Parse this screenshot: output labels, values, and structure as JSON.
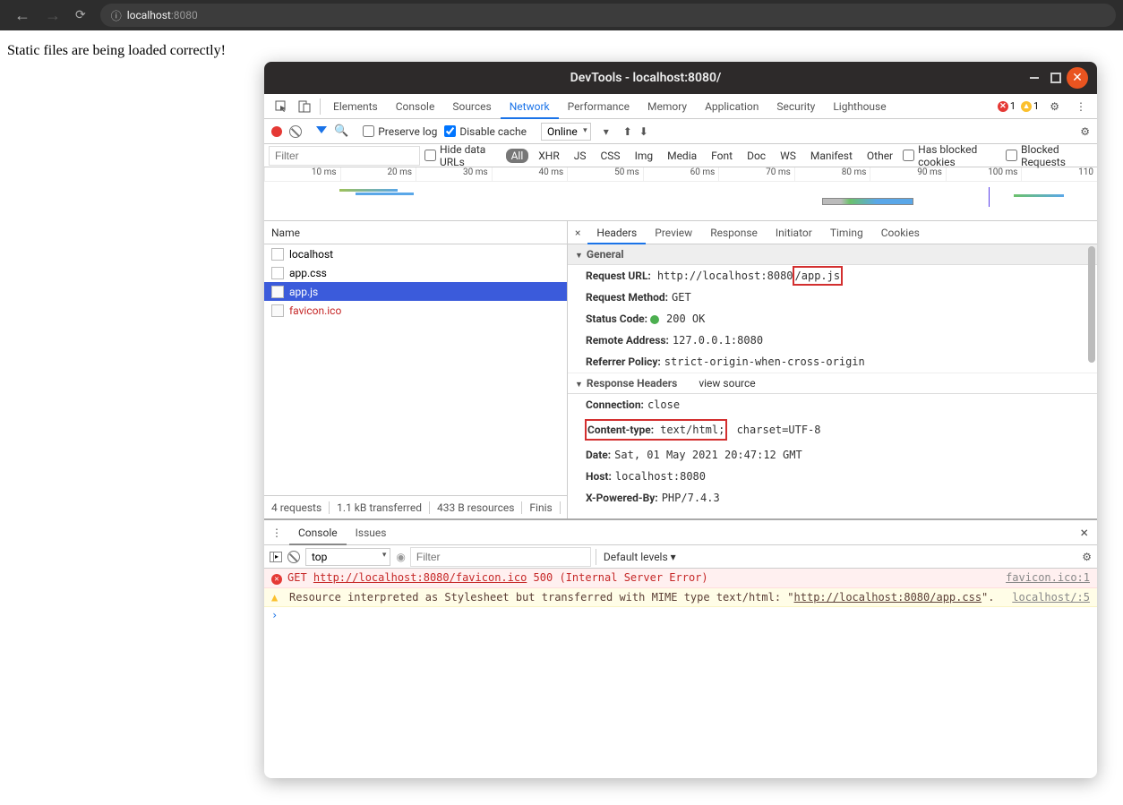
{
  "browser": {
    "url_host": "localhost",
    "url_port": ":8080",
    "info_icon": "ⓘ"
  },
  "page": {
    "body_text": "Static files are being loaded correctly!"
  },
  "devtools": {
    "title": "DevTools - localhost:8080/",
    "tabs": [
      "Elements",
      "Console",
      "Sources",
      "Network",
      "Performance",
      "Memory",
      "Application",
      "Security",
      "Lighthouse"
    ],
    "active_tab": "Network",
    "error_count": "1",
    "warn_count": "1"
  },
  "net_toolbar": {
    "preserve_log": "Preserve log",
    "disable_cache": "Disable cache",
    "throttle": "Online"
  },
  "net_filter": {
    "placeholder": "Filter",
    "hide_data": "Hide data URLs",
    "types": [
      "All",
      "XHR",
      "JS",
      "CSS",
      "Img",
      "Media",
      "Font",
      "Doc",
      "WS",
      "Manifest",
      "Other"
    ],
    "blocked_cookies": "Has blocked cookies",
    "blocked_req": "Blocked Requests"
  },
  "waterfall_labels": [
    "10 ms",
    "20 ms",
    "30 ms",
    "40 ms",
    "50 ms",
    "60 ms",
    "70 ms",
    "80 ms",
    "90 ms",
    "100 ms",
    "110"
  ],
  "requests": {
    "header": "Name",
    "rows": [
      {
        "name": "localhost",
        "cls": "doc"
      },
      {
        "name": "app.css",
        "cls": "doc"
      },
      {
        "name": "app.js",
        "cls": "sel"
      },
      {
        "name": "favicon.ico",
        "cls": "err"
      }
    ],
    "status": [
      "4 requests",
      "1.1 kB transferred",
      "433 B resources",
      "Finis"
    ]
  },
  "detail_tabs": [
    "Headers",
    "Preview",
    "Response",
    "Initiator",
    "Timing",
    "Cookies"
  ],
  "headers": {
    "general_title": "General",
    "request_url_k": "Request URL:",
    "request_url_a": "http://localhost:8080",
    "request_url_b": "/app.js",
    "method_k": "Request Method:",
    "method_v": "GET",
    "status_k": "Status Code:",
    "status_v": "200 OK",
    "remote_k": "Remote Address:",
    "remote_v": "127.0.0.1:8080",
    "ref_k": "Referrer Policy:",
    "ref_v": "strict-origin-when-cross-origin",
    "resp_title": "Response Headers",
    "view_source": "view source",
    "conn_k": "Connection:",
    "conn_v": "close",
    "ct_k": "Content-type:",
    "ct_v1": "text/html;",
    "ct_v2": " charset=UTF-8",
    "date_k": "Date:",
    "date_v": "Sat, 01 May 2021 20:47:12 GMT",
    "host_k": "Host:",
    "host_v": "localhost:8080",
    "xp_k": "X-Powered-By:",
    "xp_v": "PHP/7.4.3"
  },
  "drawer": {
    "tabs": [
      "Console",
      "Issues"
    ],
    "ctx": "top",
    "filter_ph": "Filter",
    "levels": "Default levels ▾",
    "log_err_pre": "GET ",
    "log_err_url": "http://localhost:8080/favicon.ico",
    "log_err_post": " 500 (Internal Server Error)",
    "log_err_src": "favicon.ico:1",
    "log_warn_pre": "Resource interpreted as Stylesheet but transferred with MIME type text/html: \"",
    "log_warn_url": "http://localhost:8080/app.css",
    "log_warn_post": "\".",
    "log_warn_src": "localhost/:5",
    "prompt": "›"
  }
}
